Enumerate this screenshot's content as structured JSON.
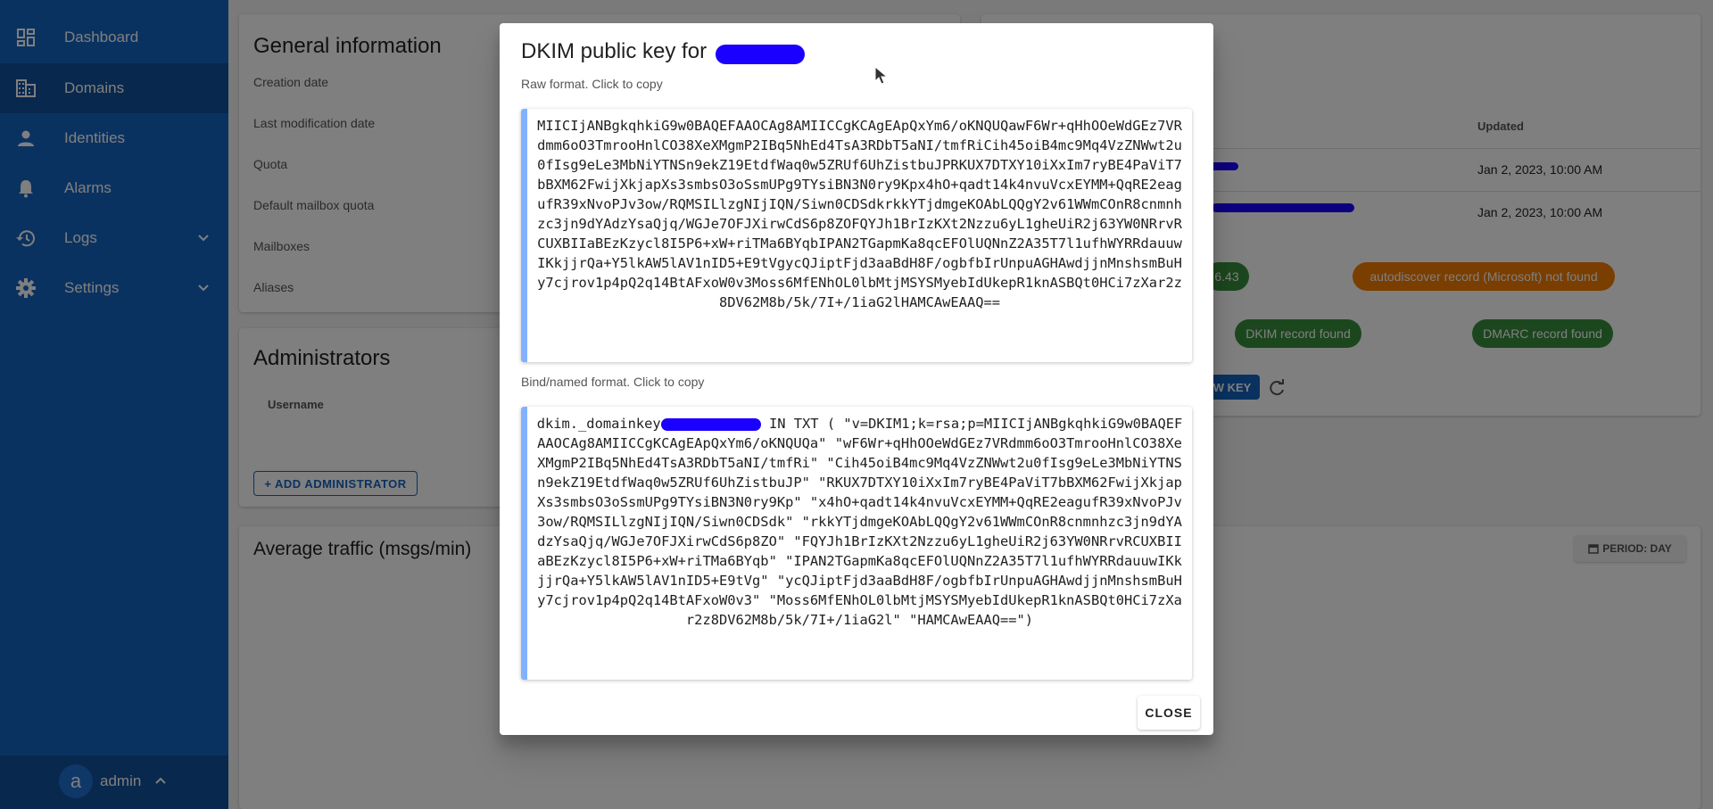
{
  "sidebar": {
    "items": [
      {
        "label": "Dashboard",
        "icon": "dashboard-icon"
      },
      {
        "label": "Domains",
        "icon": "domain-icon"
      },
      {
        "label": "Identities",
        "icon": "person-icon"
      },
      {
        "label": "Alarms",
        "icon": "bell-icon"
      },
      {
        "label": "Logs",
        "icon": "history-icon"
      },
      {
        "label": "Settings",
        "icon": "gear-icon"
      }
    ],
    "user": {
      "initial": "a",
      "name": "admin"
    }
  },
  "general": {
    "title": "General information",
    "rows": [
      "Creation date",
      "Last modification date",
      "Quota",
      "Default mailbox quota",
      "Mailboxes",
      "Aliases"
    ]
  },
  "admins": {
    "title": "Administrators",
    "column": "Username",
    "add_button": "+ ADD ADMINISTRATOR"
  },
  "traffic": {
    "title": "Average traffic (msgs/min)",
    "period_button": "PERIOD: DAY"
  },
  "dns": {
    "updated_header": "Updated",
    "rows": [
      "Jan 2, 2023, 10:00 AM",
      "Jan 2, 2023, 10:00 AM"
    ],
    "chip_partial": "6.43",
    "chip_autodiscover": "autodiscover record (Microsoft) not found",
    "chip_dkim": "DKIM record found",
    "chip_dmarc": "DMARC record found",
    "key_button": "W KEY"
  },
  "dialog": {
    "title": "DKIM public key for",
    "raw_label": "Raw format. Click to copy",
    "raw_key": "MIICIjANBgkqhkiG9w0BAQEFAAOCAg8AMIICCgKCAgEApQxYm6/oKNQUQawF6Wr+qHhOOeWdGEz7VRdmm6oO3TmrooHnlCO38XeXMgmP2IBq5NhEd4TsA3RDbT5aNI/tmfRiCih45oiB4mc9Mq4VzZNWwt2u0fIsg9eLe3MbNiYTNSn9ekZ19EtdfWaq0w5ZRUf6UhZistbuJPRKUX7DTXY10iXxIm7ryBE4PaViT7bBXM62FwijXkjapXs3smbsO3oSsmUPg9TYsiBN3N0ry9Kpx4hO+qadt14k4nvuVcxEYMM+QqRE2eagufR39xNvoPJv3ow/RQMSILlzgNIjIQN/Siwn0CDSdkrkkYTjdmgeKOAbLQQgY2v61WWmCOnR8cnmnhzc3jn9dYAdzYsaQjq/WGJe7OFJXirwCdS6p8ZOFQYJh1BrIzKXt2Nzzu6yL1gheUiR2j63YW0NRrvRCUXBIIaBEzKzycl8I5P6+xW+riTMa6BYqbIPAN2TGapmKa8qcEFOlUQNnZ2A35T7l1ufhWYRRdauuwIKkjjrQa+Y5lkAW5lAV1nID5+E9tVgycQJiptFjd3aaBdH8F/ogbfbIrUnpuAGHAwdjjnMnshsmBuHy7cjrov1p4pQ2q14BtAFxoW0v3Moss6MfENhOL0lbMtjMSYSMyebIdUkepR1knASBQt0HCi7zXar2z8DV62M8b/5k/7I+/1iaG2lHAMCAwEAAQ==",
    "bind_label": "Bind/named format. Click to copy",
    "bind_prefix": "dkim._domainkey",
    "bind_rest": " IN TXT ( \"v=DKIM1;k=rsa;p=MIICIjANBgkqhkiG9w0BAQEFAAOCAg8AMIICCgKCAgEApQxYm6/oKNQUQa\" \"wF6Wr+qHhOOeWdGEz7VRdmm6oO3TmrooHnlCO38XeXMgmP2IBq5NhEd4TsA3RDbT5aNI/tmfRi\" \"Cih45oiB4mc9Mq4VzZNWwt2u0fIsg9eLe3MbNiYTNSn9ekZ19EtdfWaq0w5ZRUf6UhZistbuJP\" \"RKUX7DTXY10iXxIm7ryBE4PaViT7bBXM62FwijXkjapXs3smbsO3oSsmUPg9TYsiBN3N0ry9Kp\" \"x4hO+qadt14k4nvuVcxEYMM+QqRE2eagufR39xNvoPJv3ow/RQMSILlzgNIjIQN/Siwn0CDSdk\" \"rkkYTjdmgeKOAbLQQgY2v61WWmCOnR8cnmnhzc3jn9dYAdzYsaQjq/WGJe7OFJXirwCdS6p8ZO\" \"FQYJh1BrIzKXt2Nzzu6yL1gheUiR2j63YW0NRrvRCUXBIIaBEzKzycl8I5P6+xW+riTMa6BYqb\" \"IPAN2TGapmKa8qcEFOlUQNnZ2A35T7l1ufhWYRRdauuwIKkjjrQa+Y5lkAW5lAV1nID5+E9tVg\" \"ycQJiptFjd3aaBdH8F/ogbfbIrUnpuAGHAwdjjnMnshsmBuHy7cjrov1p4pQ2q14BtAFxoW0v3\" \"Moss6MfENhOL0lbMtjMSYSMyebIdUkepR1knASBQt0HCi7zXar2z8DV62M8b/5k/7I+/1iaG2l\" \"HAMCAwEAAQ==\")",
    "close": "CLOSE"
  }
}
